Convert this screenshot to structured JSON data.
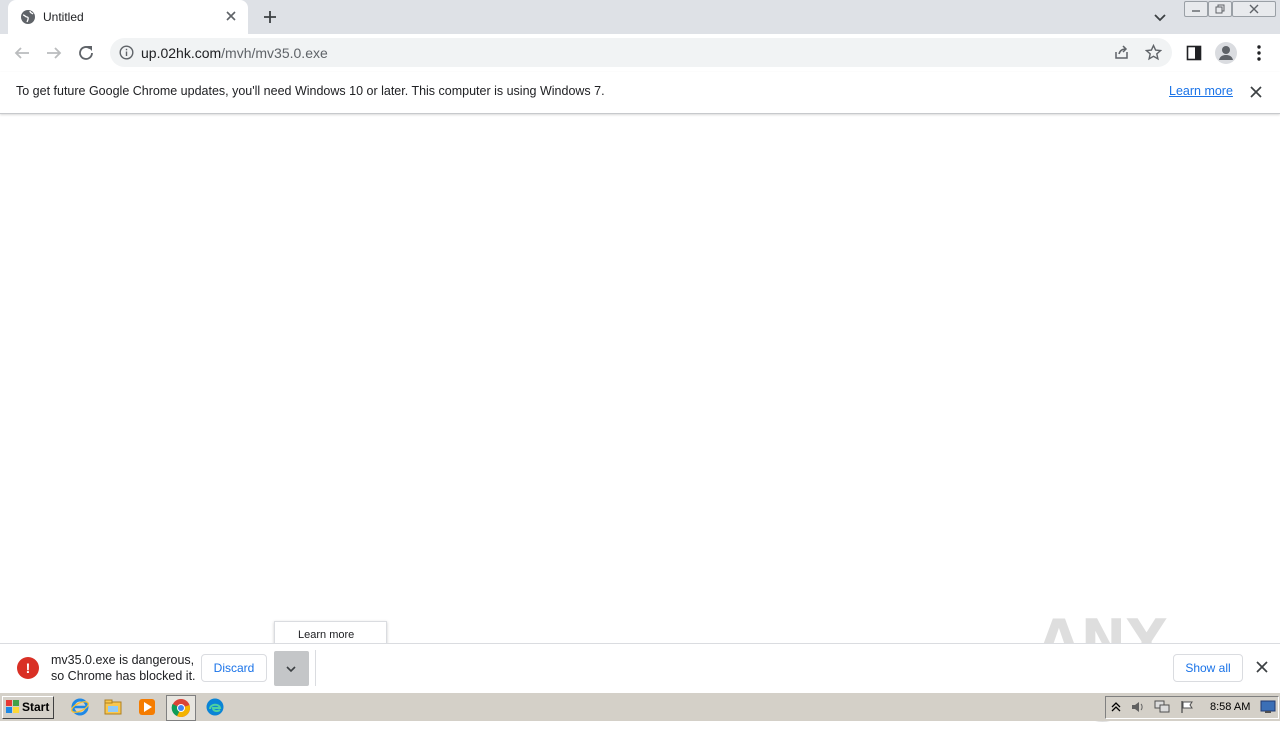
{
  "tab": {
    "title": "Untitled"
  },
  "omnibox": {
    "host": "up.02hk.com",
    "path": "/mvh/mv35.0.exe"
  },
  "infobar": {
    "message": "To get future Google Chrome updates, you'll need Windows 10 or later. This computer is using Windows 7.",
    "learn_more": "Learn more"
  },
  "download": {
    "line1": "mv35.0.exe is dangerous,",
    "line2": "so Chrome has blocked it.",
    "discard_label": "Discard",
    "menu_item": "Learn more",
    "show_all_label": "Show all"
  },
  "watermark": "ANY RUN",
  "taskbar": {
    "start_label": "Start",
    "clock": "8:58 AM"
  },
  "colors": {
    "accent": "#1a73e8",
    "danger": "#d93025"
  }
}
